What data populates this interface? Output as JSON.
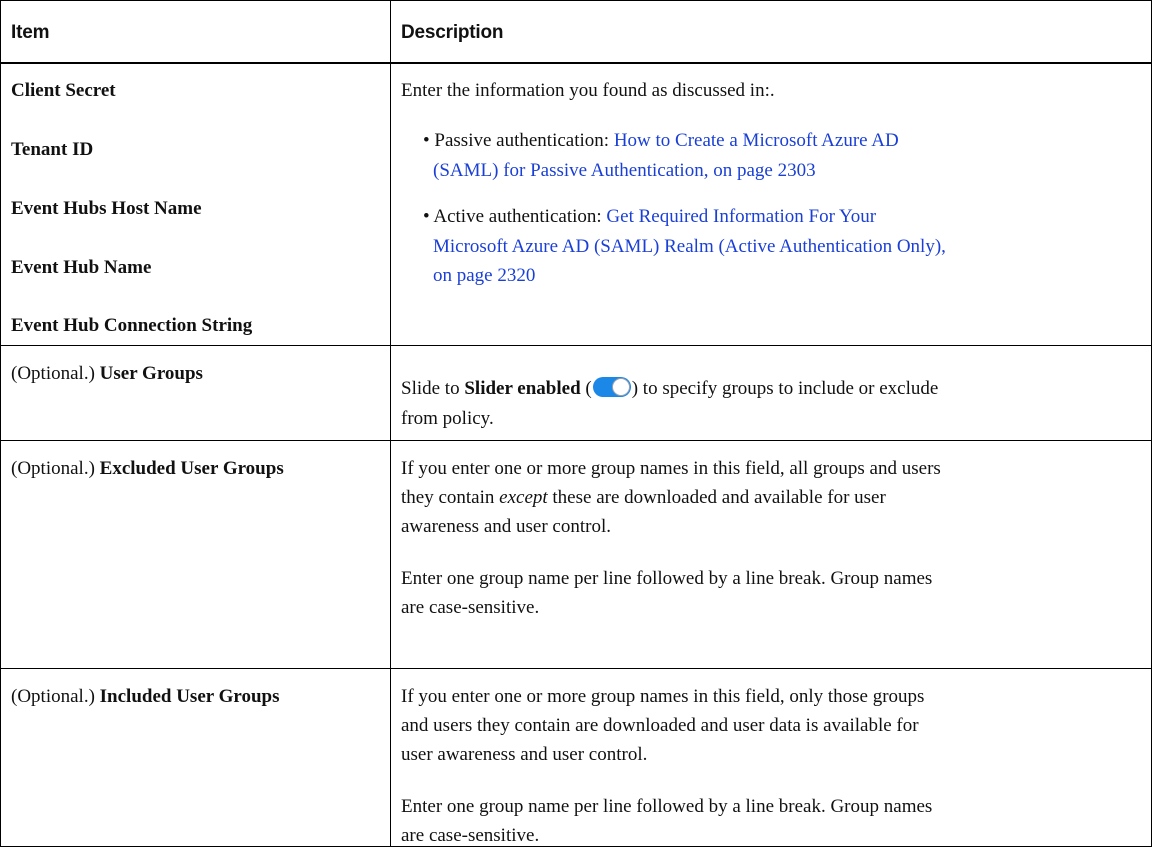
{
  "header": {
    "item": "Item",
    "description": "Description"
  },
  "cred_items": [
    "Client Secret",
    "Tenant ID",
    "Event Hubs Host Name",
    "Event Hub Name",
    "Event Hub Connection String"
  ],
  "cred_description": {
    "intro": "Enter the information you found as discussed in:.",
    "passive_prefix": "Passive authentication: ",
    "passive_link_line1": "How to Create a Microsoft Azure AD",
    "passive_link_line2": "(SAML) for Passive Authentication, on page 2303",
    "active_prefix": "Active authentication: ",
    "active_link_line1": "Get Required Information For Your",
    "active_link_line2": "Microsoft Azure AD (SAML) Realm (Active Authentication Only),",
    "active_link_line3": "on page 2320"
  },
  "user_groups": {
    "optional": "(Optional.) ",
    "name": "User Groups",
    "desc_pre": "Slide to ",
    "desc_bold": "Slider enabled",
    "desc_open": " (",
    "desc_close": ") to specify groups to include or exclude",
    "desc_line2": "from policy.",
    "toggle_icon": "toggle-on-icon",
    "toggle_color": "#1b87e6"
  },
  "excluded": {
    "optional": "(Optional.) ",
    "name": "Excluded User Groups",
    "p1_line1_pre": "If you enter one or more group names in this field, all groups and users",
    "p1_line2_italic": "except",
    "p1_line2_post": " these are downloaded and available for user",
    "p1_line2_pre": "they contain ",
    "p1_line3": "awareness and user control.",
    "p2_line1": "Enter one group name per line followed by a line break. Group names",
    "p2_line2": "are case-sensitive."
  },
  "included": {
    "optional": "(Optional.) ",
    "name": "Included User Groups",
    "p1_line1": "If you enter one or more group names in this field,  only those groups",
    "p1_line2": "and users they contain are downloaded and user data is available for",
    "p1_line3": "user awareness and user control.",
    "p2_line1": "Enter one group name per line followed by a line break. Group names",
    "p2_line2": "are case-sensitive."
  }
}
